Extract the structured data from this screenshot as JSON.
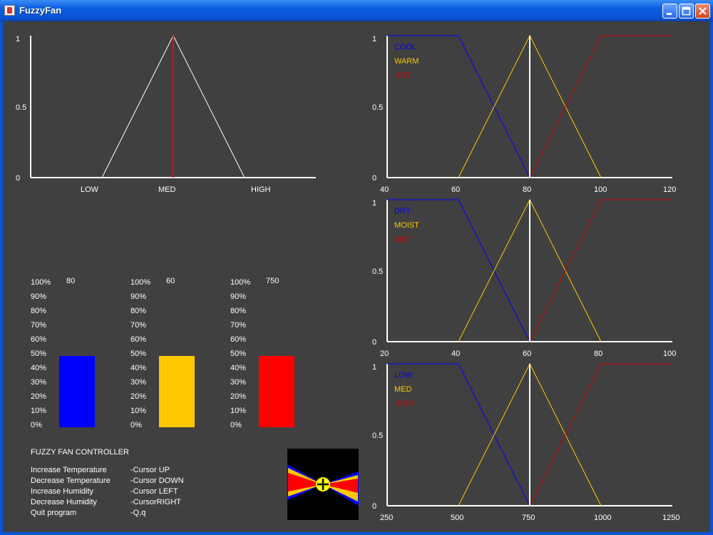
{
  "window": {
    "title": "FuzzyFan"
  },
  "output_chart": {
    "y_ticks": [
      "1",
      "0.5",
      "0"
    ],
    "x_ticks": [
      "LOW",
      "MED",
      "HIGH"
    ]
  },
  "temperature_chart": {
    "x_ticks": [
      "40",
      "60",
      "80",
      "100",
      "120"
    ],
    "y_ticks": [
      "1",
      "0.5",
      "0"
    ],
    "legend": [
      "COOL",
      "WARM",
      "HOT"
    ],
    "current_value": 80
  },
  "humidity_chart": {
    "x_ticks": [
      "20",
      "40",
      "60",
      "80",
      "100"
    ],
    "y_ticks": [
      "1",
      "0.5",
      "0"
    ],
    "legend": [
      "DRY",
      "MOIST",
      "WET"
    ],
    "current_value": 60
  },
  "speed_chart": {
    "x_ticks": [
      "250",
      "500",
      "750",
      "1000",
      "1250"
    ],
    "y_ticks": [
      "1",
      "0.5",
      "0"
    ],
    "legend": [
      "LOW",
      "MED",
      "HIGH"
    ],
    "current_value": 750
  },
  "bar_scale": [
    "100%",
    "90%",
    "80%",
    "70%",
    "60%",
    "50%",
    "40%",
    "30%",
    "20%",
    "10%",
    "0%"
  ],
  "gauges": [
    {
      "value_label": "80",
      "level": 0.5,
      "color": "#0000ff"
    },
    {
      "value_label": "60",
      "level": 0.5,
      "color": "#ffc800"
    },
    {
      "value_label": "750",
      "level": 0.5,
      "color": "#ff0000"
    }
  ],
  "help": {
    "heading": "FUZZY FAN CONTROLLER",
    "rows": [
      {
        "action": "Increase Temperature",
        "key": "-Cursor UP"
      },
      {
        "action": "Decrease Temperature",
        "key": "-Cursor DOWN"
      },
      {
        "action": "Increase Humidity",
        "key": "-Cursor LEFT"
      },
      {
        "action": "Decrease Humidity",
        "key": "-CursorRIGHT"
      },
      {
        "action": "Quit program",
        "key": "-Q,q"
      }
    ]
  },
  "colors": {
    "low": "#0000ff",
    "mid": "#ffc800",
    "high": "#cc0000",
    "background": "#404040"
  }
}
